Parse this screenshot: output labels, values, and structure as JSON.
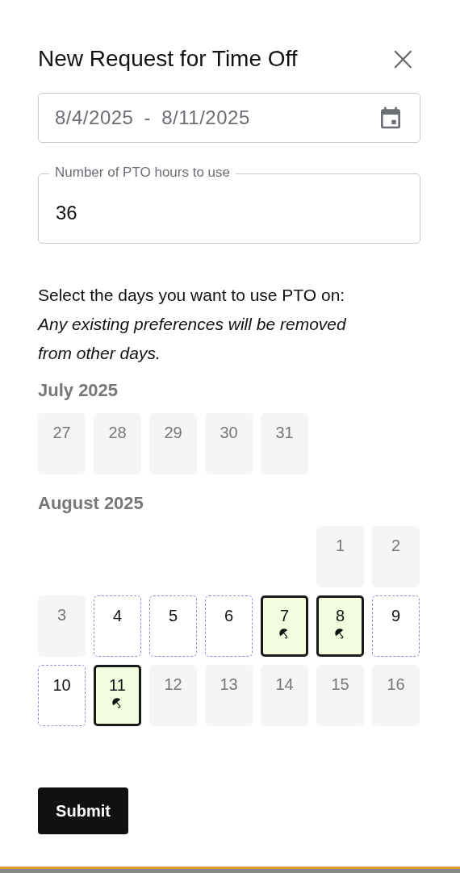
{
  "dialog": {
    "title": "New Request for Time Off",
    "close": "×"
  },
  "date_range": {
    "value": "8/4/2025 - 8/11/2025"
  },
  "hours_field": {
    "label": "Number of PTO hours to use",
    "value": "36"
  },
  "instruction": "Select the days you want to use PTO on:",
  "note": "Any existing preferences will be removed from other days.",
  "months": [
    {
      "title": "July 2025",
      "weeks": [
        [
          {
            "day": "27",
            "kind": "unavailable",
            "selected": false
          },
          {
            "day": "28",
            "kind": "unavailable",
            "selected": false
          },
          {
            "day": "29",
            "kind": "unavailable",
            "selected": false
          },
          {
            "day": "30",
            "kind": "unavailable",
            "selected": false
          },
          {
            "day": "31",
            "kind": "unavailable",
            "selected": false
          }
        ]
      ]
    },
    {
      "title": "August 2025",
      "weeks": [
        [
          {
            "day": "1",
            "kind": "unavailable",
            "selected": false
          },
          {
            "day": "2",
            "kind": "unavailable",
            "selected": false
          }
        ],
        [
          {
            "day": "3",
            "kind": "unavailable",
            "selected": false
          },
          {
            "day": "4",
            "kind": "available",
            "selected": false
          },
          {
            "day": "5",
            "kind": "available",
            "selected": false
          },
          {
            "day": "6",
            "kind": "available",
            "selected": false
          },
          {
            "day": "7",
            "kind": "available",
            "selected": true
          },
          {
            "day": "8",
            "kind": "available",
            "selected": true
          },
          {
            "day": "9",
            "kind": "available",
            "selected": false
          }
        ],
        [
          {
            "day": "10",
            "kind": "available",
            "selected": false
          },
          {
            "day": "11",
            "kind": "available",
            "selected": true
          },
          {
            "day": "12",
            "kind": "unavailable",
            "selected": false
          },
          {
            "day": "13",
            "kind": "unavailable",
            "selected": false
          },
          {
            "day": "14",
            "kind": "unavailable",
            "selected": false
          },
          {
            "day": "15",
            "kind": "unavailable",
            "selected": false
          },
          {
            "day": "16",
            "kind": "unavailable",
            "selected": false
          }
        ]
      ]
    }
  ],
  "submit": "Submit"
}
